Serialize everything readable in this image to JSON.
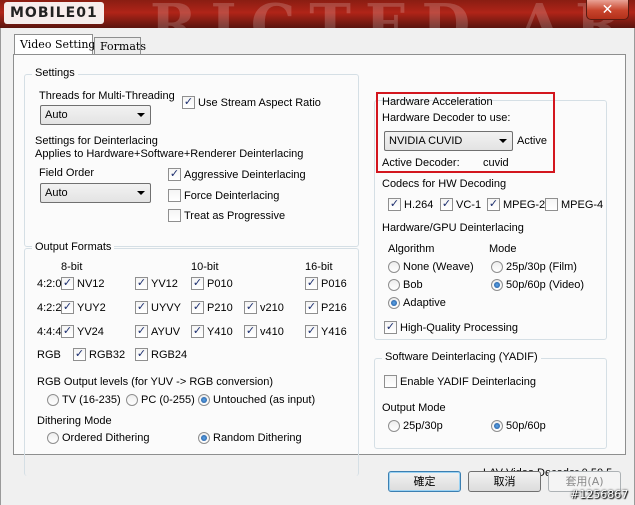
{
  "header": {
    "logo_text": "MOBILE01",
    "background_text": "RICTED AR",
    "close_label": "✕"
  },
  "tabs": [
    {
      "label": "Video Settings"
    },
    {
      "label": "Formats"
    }
  ],
  "settings": {
    "group_label": "Settings",
    "threads_label": "Threads for Multi-Threading",
    "threads_value": "Auto",
    "stream_aspect_label": "Use Stream Aspect Ratio",
    "stream_aspect_checked": "✓",
    "deint_title": "Settings for Deinterlacing",
    "deint_applies": "Applies to Hardware+Software+Renderer Deinterlacing",
    "field_order_label": "Field Order",
    "field_order_value": "Auto",
    "aggressive_label": "Aggressive Deinterlacing",
    "aggressive_checked": "✓",
    "force_label": "Force Deinterlacing",
    "progressive_label": "Treat as Progressive"
  },
  "output_formats": {
    "group_label": "Output Formats",
    "col_8bit": "8-bit",
    "col_10bit": "10-bit",
    "col_16bit": "16-bit",
    "rows": [
      {
        "label": "4:2:0",
        "items": [
          "NV12",
          "YV12",
          "P010",
          "P016"
        ]
      },
      {
        "label": "4:2:2",
        "items": [
          "YUY2",
          "UYVY",
          "P210",
          "v210",
          "P216"
        ]
      },
      {
        "label": "4:4:4",
        "items": [
          "YV24",
          "AYUV",
          "Y410",
          "v410",
          "Y416"
        ]
      },
      {
        "label": "RGB",
        "items": [
          "RGB32",
          "RGB24"
        ]
      }
    ],
    "check_mark": "✓",
    "levels_label": "RGB Output levels (for YUV -> RGB conversion)",
    "levels_options": [
      "TV (16-235)",
      "PC (0-255)",
      "Untouched (as input)"
    ],
    "dithering_label": "Dithering Mode",
    "dithering_options": [
      "Ordered Dithering",
      "Random Dithering"
    ]
  },
  "hw_accel": {
    "group_label": "Hardware Acceleration",
    "decoder_label": "Hardware Decoder to use:",
    "decoder_value": "NVIDIA CUVID",
    "decoder_status": "Active",
    "active_decoder_label": "Active Decoder:",
    "active_decoder_value": "cuvid",
    "codecs_label": "Codecs for HW Decoding",
    "codecs": [
      "H.264",
      "VC-1",
      "MPEG-2",
      "MPEG-4"
    ],
    "deint_label": "Hardware/GPU Deinterlacing",
    "algorithm_label": "Algorithm",
    "algorithm_options": [
      "None (Weave)",
      "Bob",
      "Adaptive"
    ],
    "mode_label": "Mode",
    "mode_options": [
      "25p/30p (Film)",
      "50p/60p (Video)"
    ],
    "hq_label": "High-Quality Processing"
  },
  "sw_deint": {
    "group_label": "Software Deinterlacing (YADIF)",
    "enable_label": "Enable YADIF Deinterlacing",
    "output_mode_label": "Output Mode",
    "output_options": [
      "25p/30p",
      "50p/60p"
    ]
  },
  "version": "LAV Video Decoder 0.50.5",
  "buttons": {
    "ok": "確定",
    "cancel": "取消",
    "apply": "套用(A)"
  },
  "watermark": "#1256867"
}
